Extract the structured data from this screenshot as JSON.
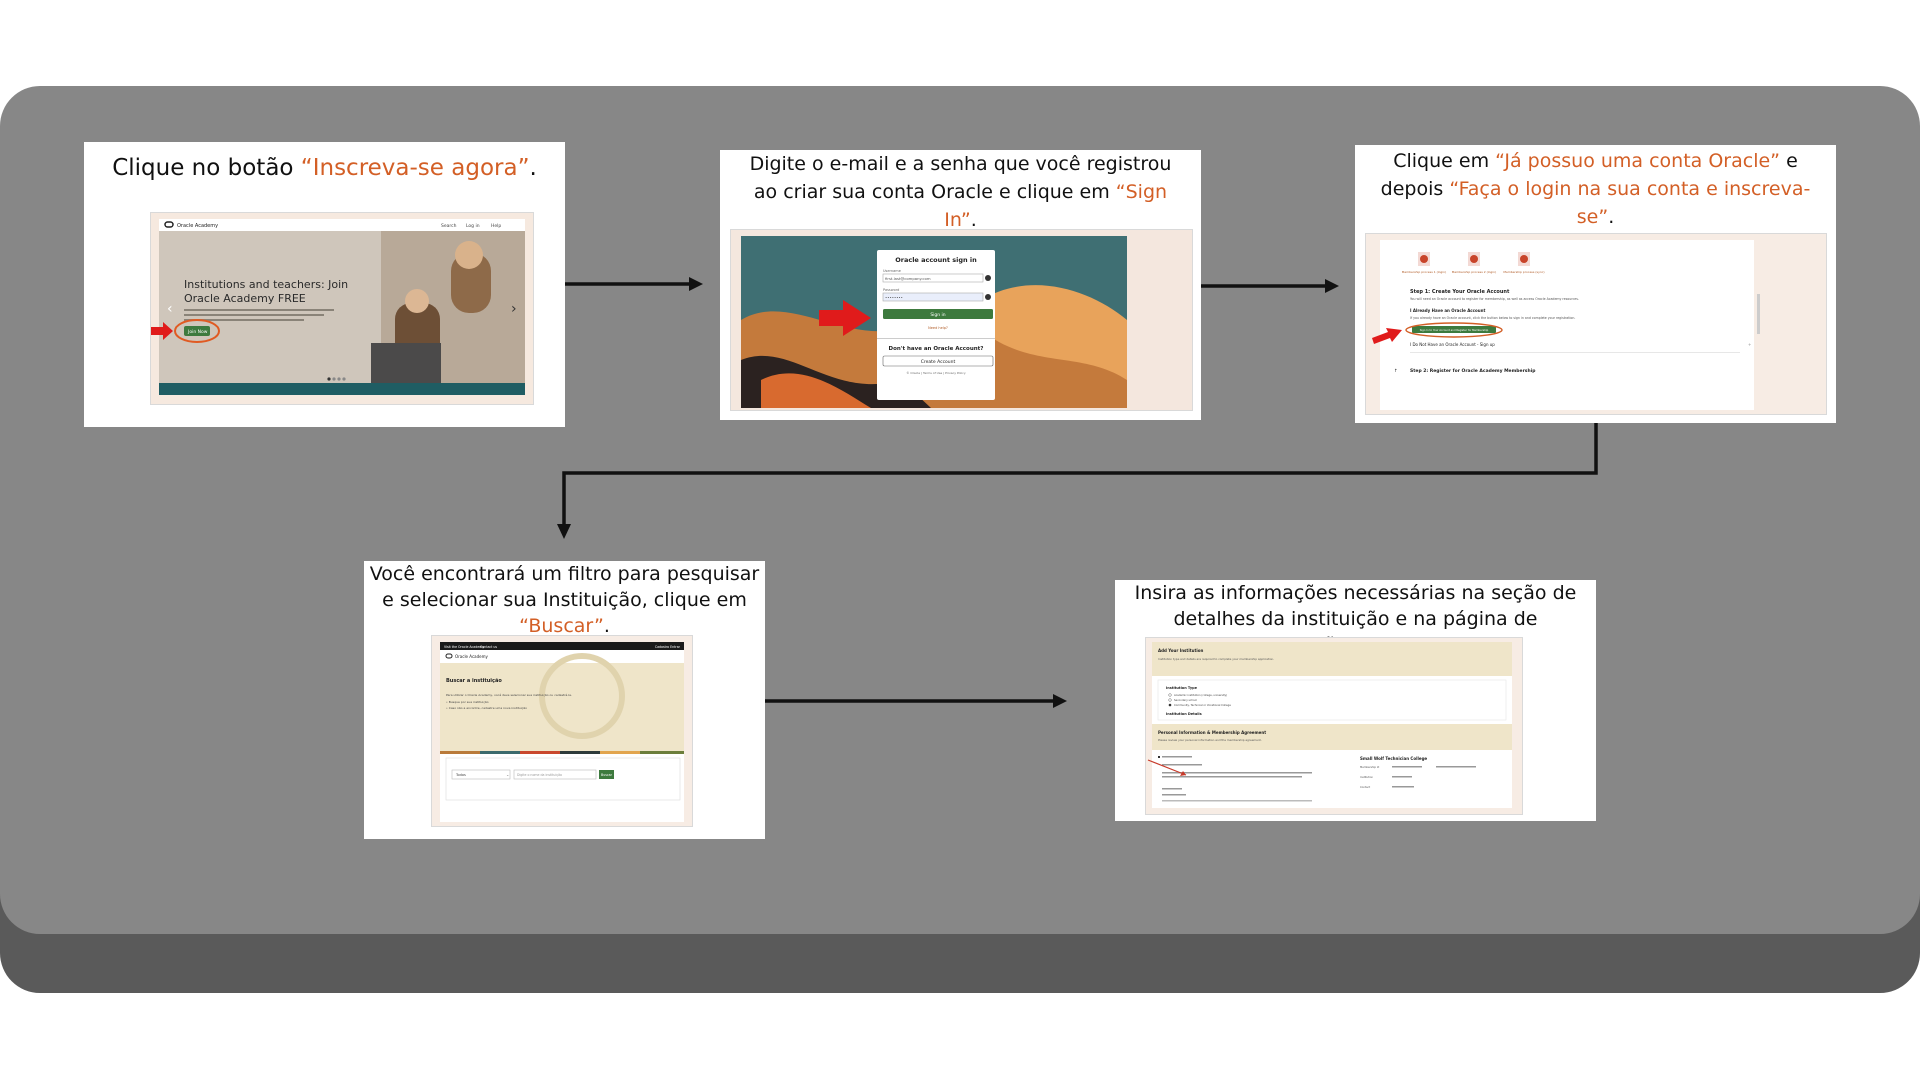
{
  "steps": [
    {
      "pre": "Clique no botão ",
      "hl": "“Inscreva-se agora”",
      "post": "."
    },
    {
      "pre": "Digite o e-mail e a senha que você registrou ao criar sua conta Oracle e clique em ",
      "hl": "“Sign In”",
      "post": "."
    },
    {
      "pre": "Clique em ",
      "hl": "“Já possuo uma conta Oracle”",
      "mid": " e depois ",
      "hl2": "“Faça o login na sua conta e inscreva-se”",
      "post": "."
    },
    {
      "pre": "Você encontrará um filtro para pesquisar e selecionar sua Instituição, clique em ",
      "hl": "“Buscar”",
      "post": "."
    },
    {
      "text": "Insira as informações necessárias na seção de detalhes da instituição e na página de informações de contato."
    }
  ],
  "shot1": {
    "brand": "Oracle Academy",
    "nav": [
      "Search",
      "Log in",
      "Help"
    ],
    "hero_line1": "Institutions and teachers: Join",
    "hero_line2": "Oracle Academy FREE",
    "body": "Oracle Academy provides you with a full range of FREE teaching resources, including curriculum, classroom learning resources, software, cloud technology, practice environments, and much more.",
    "button": "Join Now"
  },
  "shot2": {
    "title": "Oracle account sign in",
    "user_label": "Username",
    "user_value": "first.last@company.com",
    "pass_label": "Password",
    "pass_value": "••••••••",
    "sign_in": "Sign in",
    "help": "Need help?",
    "no_account": "Don't have an Oracle Account?",
    "create": "Create Account",
    "footer": "© Oracle | Terms of Use | Privacy Policy"
  },
  "shot3": {
    "icons": [
      "Membership process 1 (login)",
      "Membership process 2 (login)",
      "Membership process (sync)"
    ],
    "step1": "Step 1: Create Your Oracle Account",
    "step1_text": "You will need an Oracle account to register for membership, as well as access Oracle Academy resources.",
    "have_account": "I Already Have an Oracle Account",
    "have_text": "If you already have an Oracle account, click the button below to sign in and complete your registration.",
    "login_button": "Sign In to Your Account and Register for Membership",
    "no_account": "I Do Not Have an Oracle Account - Sign up",
    "step2": "Step 2: Register for Oracle Academy Membership"
  },
  "shot4": {
    "top_left": "Visit the Oracle Academy",
    "top_mid": "Contact us",
    "top_right": "Cadastro  Entrar",
    "brand": "Oracle Academy",
    "heading": "Buscar a instituição",
    "text1": "Para utilizar o Oracle Academy, você deve selecionar sua instituição ou cadastrá-la.",
    "text2": "• Busque por sua instituição",
    "text3": "• Caso não a encontre, cadastre uma nova instituição",
    "select": "Todos",
    "placeholder": "Digite o nome da instituição",
    "button": "Buscar"
  },
  "shot5": {
    "title1": "Add Your Institution",
    "text1": "Institution type and details are required to complete your membership application.",
    "inst_type": "Institution Type",
    "opt1": "Academic institution (college, university)",
    "opt2": "Secondary school",
    "opt3": "Community, Technical or Vocational College",
    "inst_details": "Institution Details",
    "title2": "Personal Information & Membership Agreement",
    "text2": "Please review your personal information and the membership agreement.",
    "college": "Small Wolf Technician College",
    "field1": "Membership Id",
    "field2": "Institution",
    "field3": "Contact"
  },
  "colors": {
    "accent": "#d35f26",
    "panel": "#878787",
    "panel_shadow": "#5a5a5a",
    "oracle_green": "#3d7a3e"
  }
}
